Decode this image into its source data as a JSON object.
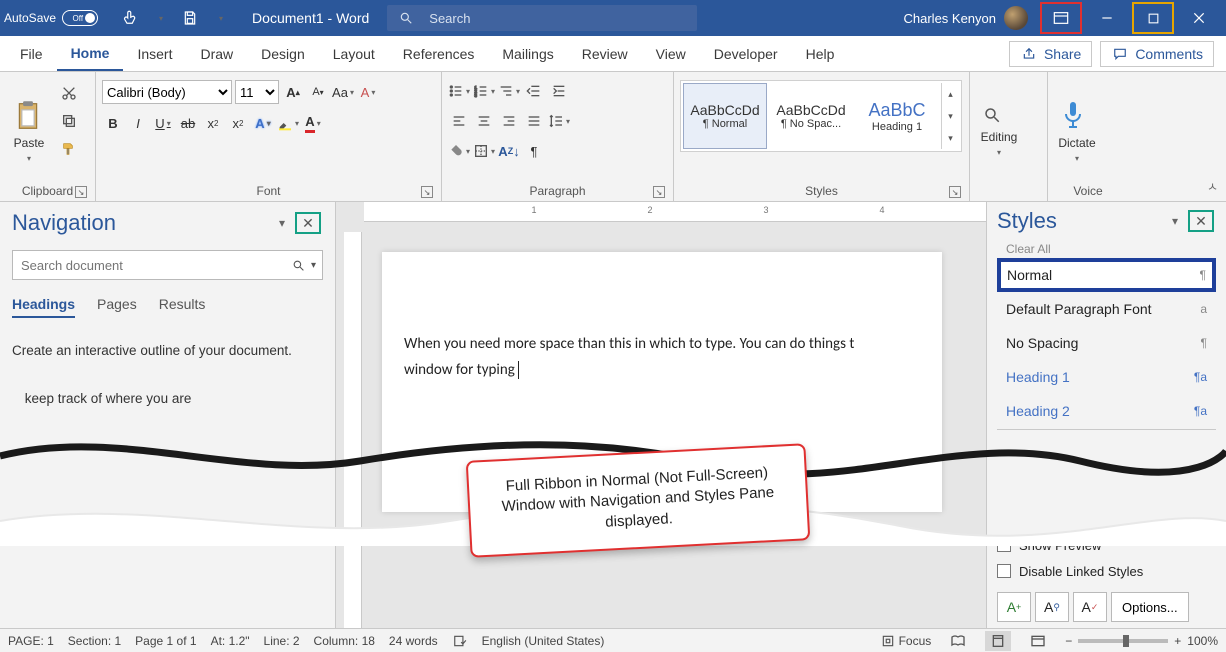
{
  "titlebar": {
    "autosave_label": "AutoSave",
    "autosave_state": "Off",
    "doc_title": "Document1  -  Word",
    "search_placeholder": "Search",
    "user_name": "Charles Kenyon"
  },
  "tabs": {
    "file": "File",
    "home": "Home",
    "insert": "Insert",
    "draw": "Draw",
    "design": "Design",
    "layout": "Layout",
    "references": "References",
    "mailings": "Mailings",
    "review": "Review",
    "view": "View",
    "developer": "Developer",
    "help": "Help",
    "share": "Share",
    "comments": "Comments"
  },
  "ribbon": {
    "clipboard": {
      "label": "Clipboard",
      "paste": "Paste"
    },
    "font": {
      "label": "Font",
      "name": "Calibri (Body)",
      "size": "11"
    },
    "paragraph": {
      "label": "Paragraph"
    },
    "styles": {
      "label": "Styles",
      "preview": "AaBbCcDd",
      "preview_heading": "AaBbC",
      "normal": "¶ Normal",
      "no_spacing": "¶ No Spac...",
      "heading1": "Heading 1"
    },
    "editing": {
      "label": "Editing",
      "btn": "Editing"
    },
    "voice": {
      "label": "Voice",
      "btn": "Dictate"
    }
  },
  "nav": {
    "title": "Navigation",
    "search_placeholder": "Search document",
    "tabs": {
      "headings": "Headings",
      "pages": "Pages",
      "results": "Results"
    },
    "msg1": "Create an interactive outline of your document.",
    "msg2_partial": "keep track of where you are"
  },
  "document": {
    "line1": "When you need more space than this in which to type. You can do things t",
    "line2": "window for typing"
  },
  "stylespane": {
    "title": "Styles",
    "clear_all": "Clear All",
    "items": [
      {
        "label": "Normal",
        "glyph": "¶"
      },
      {
        "label": "Default Paragraph Font",
        "glyph": "a"
      },
      {
        "label": "No Spacing",
        "glyph": "¶"
      },
      {
        "label": "Heading 1",
        "glyph": "¶a"
      },
      {
        "label": "Heading 2",
        "glyph": "¶a"
      }
    ],
    "show_preview": "Show Preview",
    "disable_linked": "Disable Linked Styles",
    "options": "Options..."
  },
  "callout": "Full Ribbon in Normal (Not Full-Screen)  Window with Navigation and Styles Pane displayed.",
  "ruler": {
    "n1": "1",
    "n2": "2",
    "n3": "3",
    "n4": "4"
  },
  "status": {
    "page": "PAGE: 1",
    "section": "Section: 1",
    "page_of": "Page 1 of 1",
    "at": "At: 1.2\"",
    "line": "Line: 2",
    "column": "Column: 18",
    "words": "24 words",
    "lang": "English (United States)",
    "focus": "Focus",
    "zoom": "100%"
  }
}
